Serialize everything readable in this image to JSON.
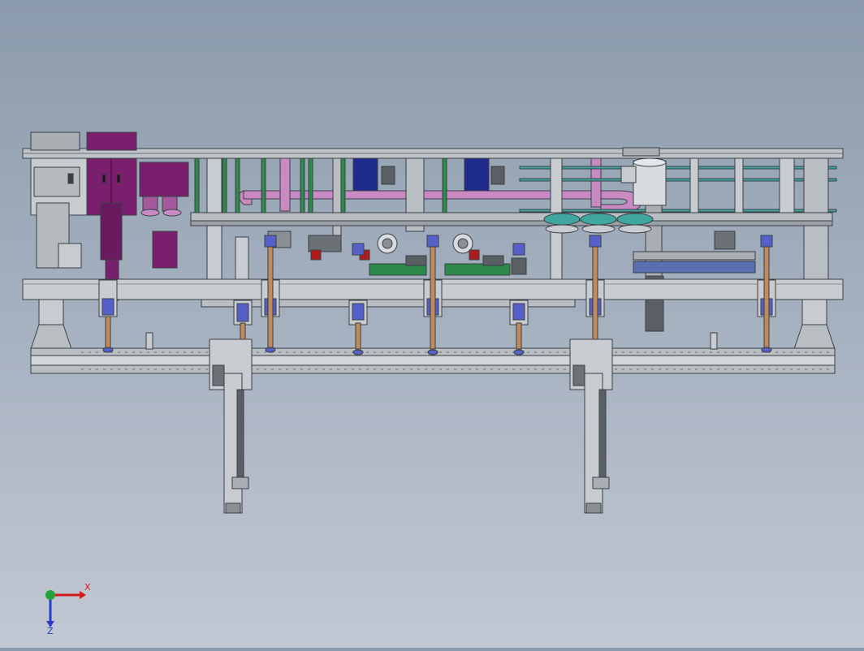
{
  "viewport": {
    "background_top": "#8b9aac",
    "background_bottom": "#c2c8d3"
  },
  "model": {
    "colors": {
      "frame": "#b9bec3",
      "frame_edge": "#3a3f44",
      "panel_grey": "#c8ccd0",
      "purple_block": "#7a1f6e",
      "pink_duct": "#c98ac4",
      "blue_cylinder": "#1e2a8c",
      "sensor_blue": "#5560c8",
      "copper_rod": "#c08a5a",
      "green_rail": "#2e8a4a",
      "teal_rail": "#3fa6a0",
      "red_valve": "#b01c1c",
      "rail_dark": "#6c7176"
    }
  },
  "triad": {
    "x_label": "X",
    "z_label": "Z",
    "x_icon": "x-axis-arrow-icon",
    "z_icon": "z-axis-arrow-icon",
    "y_icon": "y-axis-dot-icon"
  }
}
